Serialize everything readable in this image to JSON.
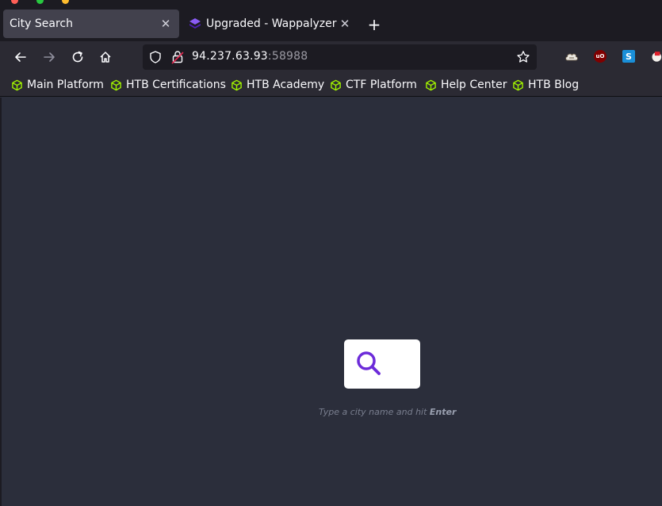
{
  "tabs": [
    {
      "title": "City Search",
      "active": true
    },
    {
      "title": "Upgraded - Wappalyzer",
      "active": false,
      "favicon": "wappalyzer-icon"
    }
  ],
  "address_bar": {
    "host": "94.237.63.93",
    "port": ":58988"
  },
  "bookmarks": [
    {
      "label": "Main Platform"
    },
    {
      "label": "HTB Certifications"
    },
    {
      "label": "HTB Academy"
    },
    {
      "label": "CTF Platform"
    },
    {
      "label": "Help Center"
    },
    {
      "label": "HTB Blog"
    }
  ],
  "extensions": [
    "wappalyzer-cloud-icon",
    "ublock-icon",
    "s-extension-icon",
    "extension-icon"
  ],
  "page": {
    "hint_prefix": "Type a city name and hit ",
    "hint_key": "Enter"
  },
  "colors": {
    "accent": "#6c2bd9",
    "bookmark_icon": "#9fef00",
    "page_background": "#2b2e3b"
  }
}
